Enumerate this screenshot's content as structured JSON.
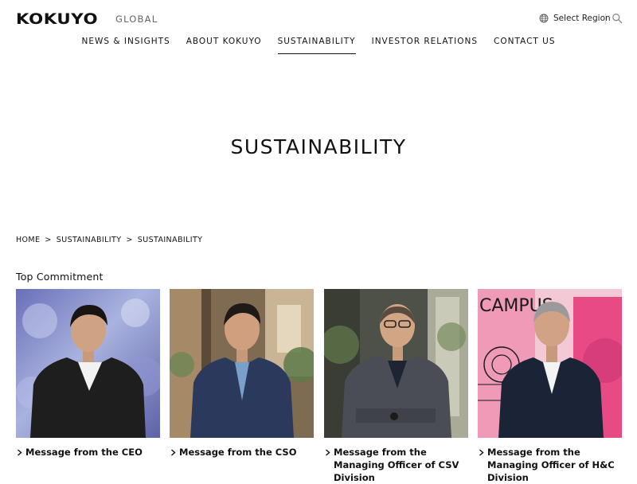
{
  "header": {
    "logo": "KOKUYO",
    "logo_sub": "GLOBAL",
    "region_label": "Select Region",
    "search_icon": "search-icon",
    "region_icon": "globe-icon"
  },
  "nav": {
    "items": [
      {
        "label": "NEWS & INSIGHTS",
        "active": false
      },
      {
        "label": "ABOUT KOKUYO",
        "active": false
      },
      {
        "label": "SUSTAINABILITY",
        "active": true
      },
      {
        "label": "INVESTOR RELATIONS",
        "active": false
      },
      {
        "label": "CONTACT US",
        "active": false
      }
    ]
  },
  "hero": {
    "title": "SUSTAINABILITY"
  },
  "breadcrumb": {
    "items": [
      "HOME",
      "SUSTAINABILITY",
      "SUSTAINABILITY"
    ],
    "separator": ">"
  },
  "section": {
    "title": "Top Commitment"
  },
  "cards": [
    {
      "label": "Message from the CEO"
    },
    {
      "label": "Message from the CSO"
    },
    {
      "label": "Message from the Managing Officer of CSV Division"
    },
    {
      "label": "Message from the Managing Officer of H&C Division"
    }
  ],
  "photo_banner_text": "CAMPUS",
  "colors": {
    "text": "#111111",
    "muted": "#666666",
    "accent": "#111111",
    "campus_pink": "#e84a86"
  }
}
